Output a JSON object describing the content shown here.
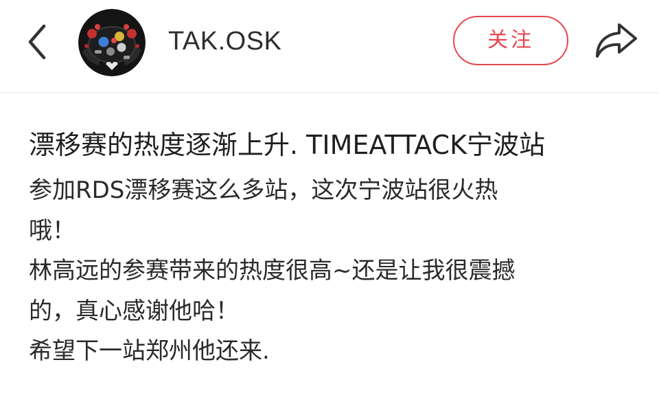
{
  "header": {
    "username": "TAK.OSK",
    "follow_label": "关注",
    "icons": {
      "back": "chevron-left-icon",
      "avatar": "steering-wheel-avatar",
      "share": "share-arrow-icon"
    }
  },
  "post": {
    "title": "漂移赛的热度逐渐上升. TIMEATTACK宁波站",
    "body_lines": [
      "参加RDS漂移赛这么多站，这次宁波站很火热",
      "哦！",
      "林高远的参赛带来的热度很高~还是让我很震撼",
      "的，真心感谢他哈！",
      "希望下一站郑州他还来."
    ]
  },
  "colors": {
    "accent": "#e6474c",
    "text": "#222222",
    "divider": "#ececec"
  }
}
